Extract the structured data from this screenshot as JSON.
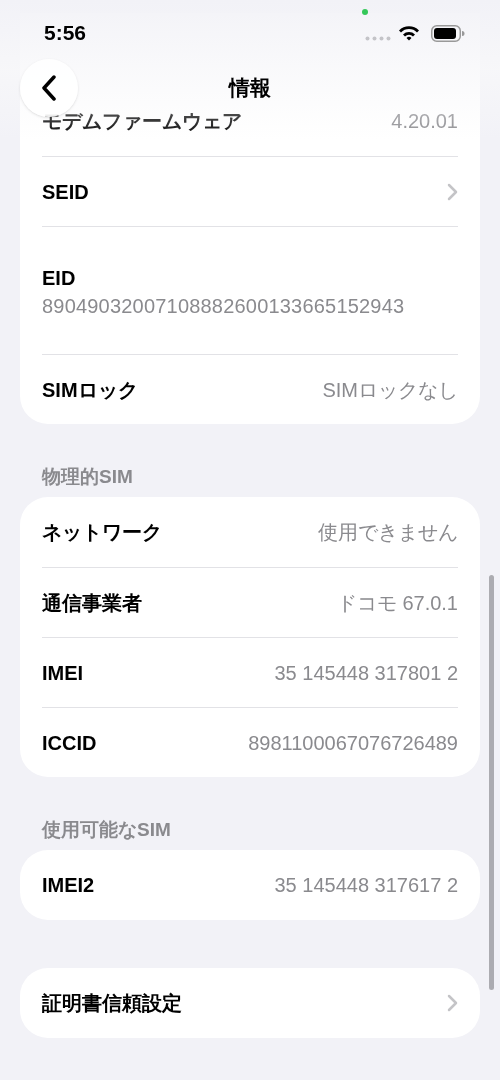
{
  "status_bar": {
    "time": "5:56"
  },
  "nav": {
    "title": "情報"
  },
  "sections": [
    {
      "rows": [
        {
          "kind": "value",
          "label": "モデムファームウェア",
          "value": "4.20.01"
        },
        {
          "kind": "chevron",
          "label": "SEID"
        },
        {
          "kind": "stacked",
          "label": "EID",
          "value": "89049032007108882600133665152943"
        },
        {
          "kind": "value",
          "label": "SIMロック",
          "value": "SIMロックなし"
        }
      ]
    },
    {
      "header": "物理的SIM",
      "rows": [
        {
          "kind": "value",
          "label": "ネットワーク",
          "value": "使用できません"
        },
        {
          "kind": "value",
          "label": "通信事業者",
          "value": "ドコモ 67.0.1"
        },
        {
          "kind": "value",
          "label": "IMEI",
          "value": "35 145448 317801 2"
        },
        {
          "kind": "value",
          "label": "ICCID",
          "value": "8981100067076726489"
        }
      ]
    },
    {
      "header": "使用可能なSIM",
      "rows": [
        {
          "kind": "value",
          "label": "IMEI2",
          "value": "35 145448 317617 2"
        }
      ]
    },
    {
      "rows": [
        {
          "kind": "chevron",
          "label": "証明書信頼設定"
        }
      ]
    }
  ]
}
